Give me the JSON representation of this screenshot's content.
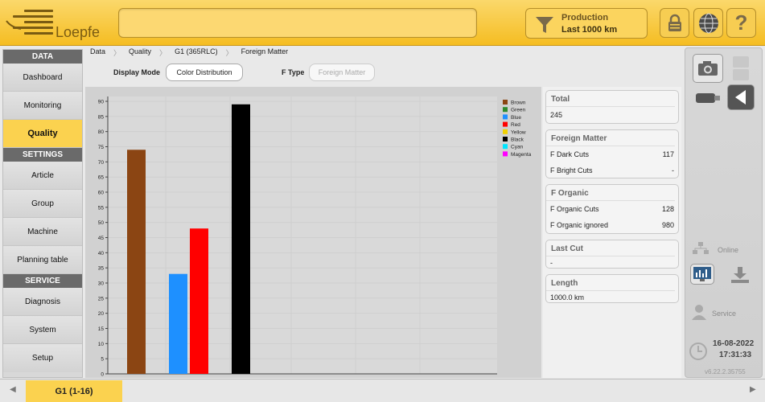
{
  "header": {
    "logo_text": "Loepfe",
    "production_title": "Production",
    "production_value": "Last 1000 km",
    "icons": [
      "funnel-icon",
      "lock-icon",
      "globe-icon",
      "help-icon"
    ]
  },
  "nav": {
    "data_header": "DATA",
    "data_items": [
      "Dashboard",
      "Monitoring",
      "Quality"
    ],
    "settings_header": "SETTINGS",
    "settings_items": [
      "Article",
      "Group",
      "Machine",
      "Planning table"
    ],
    "service_header": "SERVICE",
    "service_items": [
      "Diagnosis",
      "System",
      "Setup"
    ],
    "active": "Quality"
  },
  "breadcrumb": [
    "Data",
    "Quality",
    "G1 (365RLC)",
    "Foreign Matter"
  ],
  "options": {
    "display_mode_label": "Display Mode",
    "display_mode_value": "Color Distribution",
    "f_type_label": "F Type",
    "f_type_placeholder": "Foreign Matter"
  },
  "chart_data": {
    "type": "bar",
    "categories": [
      "Brown",
      "Green",
      "Blue",
      "Red",
      "Yellow",
      "Black",
      "Cyan",
      "Magenta"
    ],
    "values": [
      74,
      0,
      33,
      48,
      0,
      89,
      0,
      0
    ],
    "colors": [
      "#8b4513",
      "#2e8b2e",
      "#1e90ff",
      "#ff0000",
      "#f0d000",
      "#000000",
      "#00e5ff",
      "#ff00ff"
    ],
    "ylim": [
      0,
      90
    ],
    "yticks": [
      0,
      5,
      10,
      15,
      20,
      25,
      30,
      35,
      40,
      45,
      50,
      55,
      60,
      65,
      70,
      75,
      80,
      85,
      90
    ],
    "legend_position": "top-right",
    "grid": true,
    "title": "",
    "xlabel": "",
    "ylabel": ""
  },
  "summary": {
    "total_title": "Total",
    "total_value": "245",
    "fm_title": "Foreign Matter",
    "fm_rows": [
      {
        "label": "F Dark Cuts",
        "value": "117"
      },
      {
        "label": "F Bright Cuts",
        "value": "-"
      }
    ],
    "fo_title": "F Organic",
    "fo_rows": [
      {
        "label": "F Organic Cuts",
        "value": "128"
      },
      {
        "label": "F Organic ignored",
        "value": "980"
      }
    ],
    "lastcut_title": "Last Cut",
    "lastcut_value": "-",
    "length_title": "Length",
    "length_value": "1000.0 km"
  },
  "right_panel": {
    "online_label": "Online",
    "service_label": "Service",
    "date": "16-08-2022",
    "time": "17:31:33",
    "version": "v6.22.2.35755"
  },
  "bottom": {
    "tab_label": "G1 (1-16)"
  }
}
